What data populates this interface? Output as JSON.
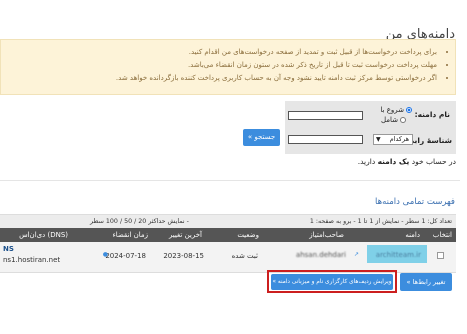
{
  "page": {
    "title": "دامنه‌های من",
    "alerts": [
      "برای پرداخت درخواست‌ها از قبیل ثبت و تمدید از صفحه درخواست‌های من اقدام کنید.",
      "مهلت پرداخت درخواست ثبت تا قبل از تاریخ ذکر شده در ستون زمان انقضاء می‌باشد.",
      "اگر درخواستی توسط مرکز ثبت دامنه تایید نشود وجه آن به حساب کاربری پرداخت کننده بازگردانده خواهد شد."
    ]
  },
  "search": {
    "name_label": "نام دامنه:",
    "radio_start": "شروع با",
    "radio_contains": "شامل",
    "id_label": "شناسهٔ رابط:",
    "select_value": "هرکدام",
    "button": "جستجو »"
  },
  "account_note": {
    "prefix": "در حساب خود",
    "bold": "یک دامنه",
    "suffix": "دارید."
  },
  "list": {
    "title": "فهرست تمامی دامنه‌ها",
    "pager_right": "تعداد کل: 1 سطر - نمایش از 1 تا 1 - برو به صفحه: 1",
    "pager_left": "- نمایش حداکثر 20 / 50 / 100 سطر",
    "columns": {
      "select": "انتخاب",
      "domain": "دامنه",
      "holder": "صاحب‌امتیاز",
      "status": "وضعیت",
      "last_change": "آخرین تغییر",
      "expiry": "زمان انقضاء",
      "dns": "دی‌ان‌اس (DNS)"
    },
    "rows": [
      {
        "domain": "architteam.ir",
        "holder": "ahsan.dehdari",
        "status": "ثبت شده",
        "last_change": "2023-08-15",
        "expiry": "2024-07-18",
        "dns_1": "NS",
        "dns_2": "ns1.hostiran.net"
      }
    ]
  },
  "actions": {
    "change_contacts": "تغییر رابط‌ها »",
    "edit_contacts": "ویرایش ردیف‌های کارگزاری نام و میزبانی دامنه »"
  },
  "colors": {
    "accent": "#3c8dde",
    "alert_bg": "#fdf3d8",
    "header_bg": "#555555",
    "highlight": "#cc1f1f"
  }
}
